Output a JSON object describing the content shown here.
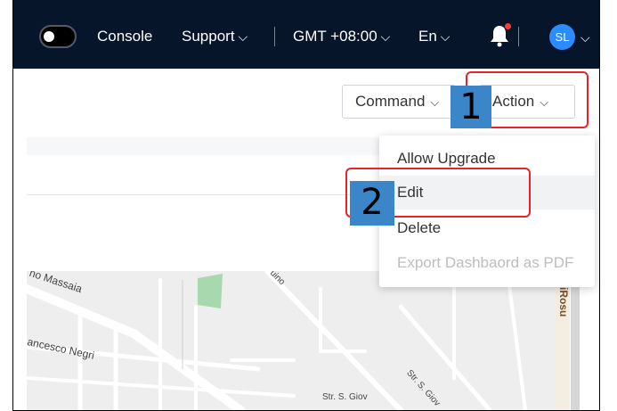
{
  "topbar": {
    "nav": [
      {
        "label": "Console"
      },
      {
        "label": "Support",
        "chevron": "⌵"
      },
      {
        "label": "GMT +08:00",
        "chevron": "⌵"
      },
      {
        "label": "En",
        "chevron": "⌵"
      }
    ],
    "avatar_initials": "SL"
  },
  "toolbar": {
    "command_label": "Command",
    "action_label": "Action"
  },
  "action_menu": {
    "items": [
      {
        "label": "Allow Upgrade",
        "state": "normal"
      },
      {
        "label": "Edit",
        "state": "hover"
      },
      {
        "label": "Delete",
        "state": "normal"
      },
      {
        "label": "Export Dashbaord as PDF",
        "state": "disabled"
      }
    ]
  },
  "map": {
    "labels": [
      "no Massaia",
      "ancesco Negri",
      "Str. S. Giov",
      "Str. S. Giov",
      "uino"
    ],
    "side_road": "iRosu"
  },
  "annotations": {
    "step1": "1",
    "step2": "2"
  },
  "colors": {
    "topbar_bg": "#07152b",
    "accent_blue": "#2b8cff",
    "highlight_red": "#e8232e",
    "step_badge": "#3a86c8"
  }
}
